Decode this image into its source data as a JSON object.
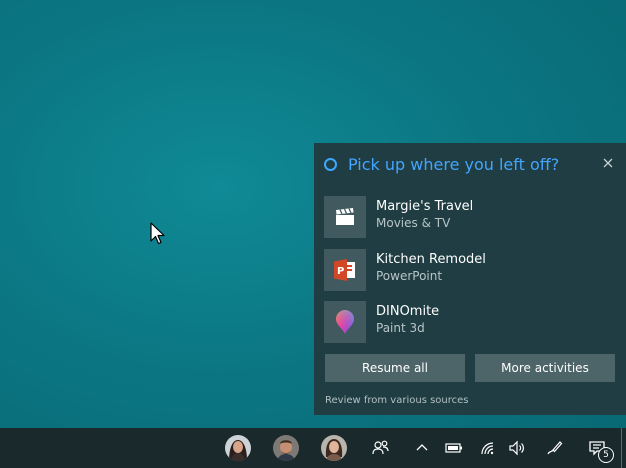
{
  "panel": {
    "title": "Pick up where you left off?",
    "activities": [
      {
        "title": "Margie's Travel",
        "app": "Movies & TV",
        "icon": "movies-clapper-icon"
      },
      {
        "title": "Kitchen Remodel",
        "app": "PowerPoint",
        "icon": "powerpoint-icon"
      },
      {
        "title": "DINOmite",
        "app": "Paint 3d",
        "icon": "paint3d-icon"
      }
    ],
    "resume_all_label": "Resume all",
    "more_activities_label": "More activities",
    "footer": "Review from various sources"
  },
  "taskbar": {
    "people": [
      "person-1-avatar",
      "person-2-avatar",
      "person-3-avatar"
    ],
    "tray_icons": [
      "people-icon",
      "chevron-up-icon",
      "battery-icon",
      "wifi-icon",
      "volume-icon",
      "pen-workspace-icon",
      "action-center-icon"
    ],
    "notification_count": "5"
  },
  "colors": {
    "accent": "#42a5ff",
    "panel_bg": "#1f3d42",
    "button_bg": "#4d6569",
    "taskbar_bg": "#1a2a2c",
    "powerpoint": "#d24726"
  }
}
